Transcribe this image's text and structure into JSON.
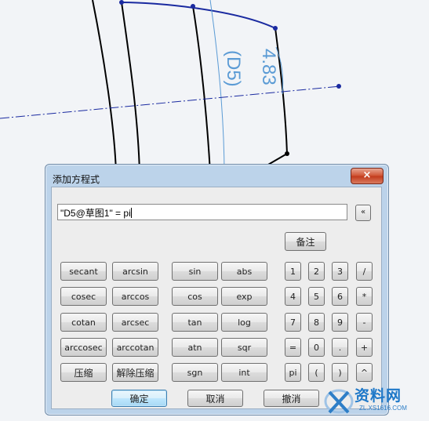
{
  "background": {
    "dimension_value": "4.83",
    "dimension_name": "(D5)",
    "colors": {
      "sketch": "#000000",
      "selected": "#1a2aa0",
      "dimension": "#5b9bd5",
      "axis": "#1a2aa0"
    }
  },
  "dialog": {
    "title": "添加方程式",
    "close_label": "×",
    "equation": "\"D5@草图1\" = pi",
    "collapse_label": "«",
    "note_button": "备注",
    "function_buttons": [
      [
        "secant",
        "arcsin",
        "sin",
        "abs"
      ],
      [
        "cosec",
        "arccos",
        "cos",
        "exp"
      ],
      [
        "cotan",
        "arcsec",
        "tan",
        "log"
      ],
      [
        "arccosec",
        "arccotan",
        "atn",
        "sqr"
      ],
      [
        "压缩",
        "解除压缩",
        "sgn",
        "int"
      ]
    ],
    "keypad": [
      [
        "1",
        "2",
        "3",
        "/"
      ],
      [
        "4",
        "5",
        "6",
        "*"
      ],
      [
        "7",
        "8",
        "9",
        "-"
      ],
      [
        "=",
        "0",
        ".",
        "+"
      ],
      [
        "pi",
        "(",
        ")",
        "^"
      ]
    ],
    "footer": {
      "ok": "确定",
      "cancel": "取消",
      "undo": "撤消"
    },
    "colors": {
      "frame": "#bcd3ea",
      "close": "#c8462a",
      "ok_border": "#3c7fb1"
    }
  },
  "watermark": {
    "text": "资料网",
    "url": "ZL.XS1616.COM"
  }
}
